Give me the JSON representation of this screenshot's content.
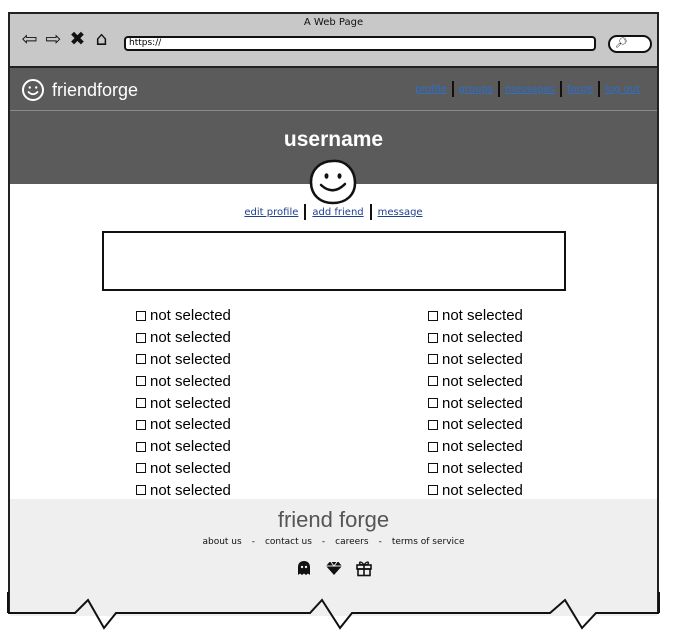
{
  "browser": {
    "title": "A Web Page",
    "url": "https://",
    "nav_icons": [
      "back-arrow-icon",
      "forward-arrow-icon",
      "close-icon",
      "home-icon"
    ],
    "search_icon": "magnifier-icon"
  },
  "header": {
    "brand": "friendforge",
    "brand_icon": "smiley-icon",
    "nav": [
      "profile",
      "groups",
      "messages",
      "forge",
      "log out"
    ],
    "username": "username",
    "background": "#5b5b5b",
    "link_color": "#2b6fc9"
  },
  "profile": {
    "avatar_icon": "smiley-avatar-icon",
    "actions": [
      "edit profile",
      "add friend",
      "message"
    ]
  },
  "checklist": {
    "left": [
      "not selected",
      "not selected",
      "not selected",
      "not selected",
      "not selected",
      "not selected",
      "not selected",
      "not selected",
      "not selected"
    ],
    "right": [
      "not selected",
      "not selected",
      "not selected",
      "not selected",
      "not selected",
      "not selected",
      "not selected",
      "not selected",
      "not selected"
    ]
  },
  "footer": {
    "title": "friend forge",
    "links": [
      "about us",
      "contact us",
      "careers",
      "terms of service"
    ],
    "social_icons": [
      "ghost-icon",
      "diamond-icon",
      "gift-icon"
    ],
    "background": "#efefef"
  }
}
